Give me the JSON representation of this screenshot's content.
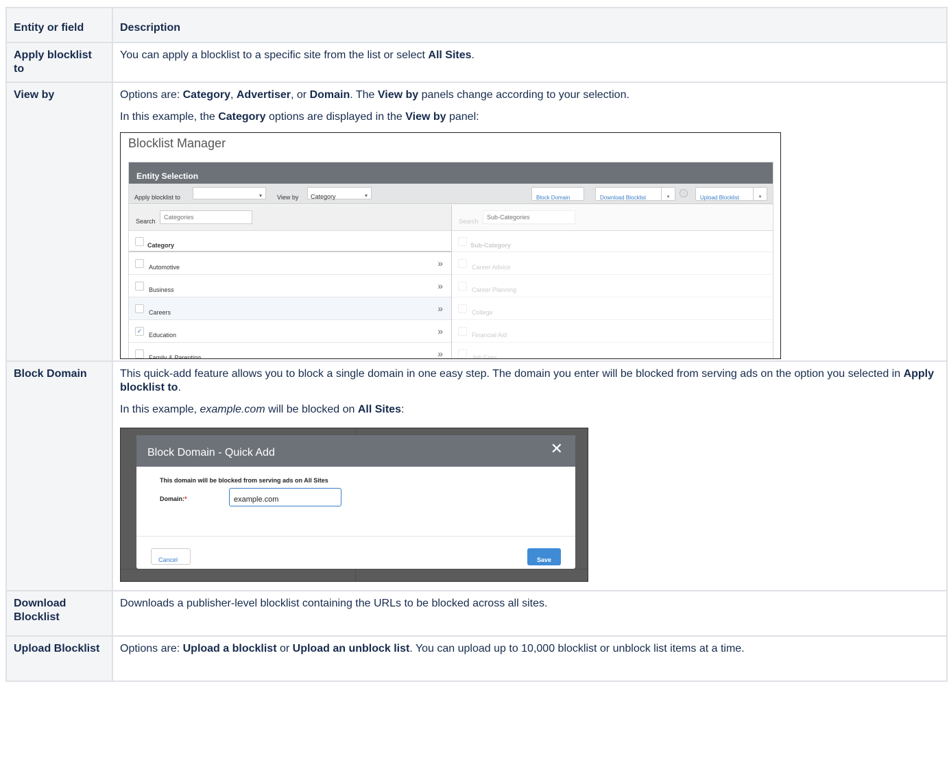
{
  "table": {
    "header_field": "Entity or field",
    "header_desc": "Description"
  },
  "rows": {
    "apply": {
      "field": "Apply blocklist to",
      "t1": "You can apply a blocklist to a specific site from the list or select ",
      "b1": "All Sites",
      "t2": "."
    },
    "viewby": {
      "field": "View by",
      "p1": {
        "t1": "Options are: ",
        "b1": "Category",
        "t2": ", ",
        "b2": "Advertiser",
        "t3": ", or ",
        "b3": "Domain",
        "t4": ". The ",
        "b4": "View by",
        "t5": " panels change according to your selection."
      },
      "p2": {
        "t1": "In this example, the ",
        "b1": "Category",
        "t2": " options are displayed in the ",
        "b2": "View by",
        "t3": " panel:"
      }
    },
    "block": {
      "field": "Block Domain",
      "p1": {
        "t1": "This quick-add feature allows you to block a single domain in one easy step. The domain you enter will be blocked from serving ads on the option you selected in ",
        "b1": "Apply blocklist to",
        "t2": "."
      },
      "p2": {
        "t1": "In this example, ",
        "i1": "example.com",
        "t2": " will be blocked on ",
        "b1": "All Sites",
        "t3": ":"
      }
    },
    "download": {
      "field": "Download Blocklist",
      "text": "Downloads a publisher-level blocklist containing the URLs to be blocked across all sites."
    },
    "upload": {
      "field": "Upload Blocklist",
      "t1": "Options are: ",
      "b1": "Upload a blocklist",
      "t2": " or ",
      "b2": "Upload an unblock list",
      "t3": ". You can upload up to 10,000 blocklist or unblock list items at a time."
    }
  },
  "blocklist_manager": {
    "title": "Blocklist Manager",
    "panel_title": "Entity Selection",
    "apply_label": "Apply blocklist to",
    "apply_value": "",
    "viewby_label": "View by",
    "viewby_value": "Category",
    "block_domain_btn": "Block Domain",
    "download_btn": "Download Blocklist",
    "upload_btn": "Upload Blocklist",
    "search_label": "Search",
    "search_placeholder": "Categories",
    "sub_search_placeholder": "Sub-Categories",
    "category_header": "Category",
    "subcategory_header": "Sub-Category",
    "categories": [
      {
        "label": "Automotive",
        "checked": false
      },
      {
        "label": "Business",
        "checked": false
      },
      {
        "label": "Careers",
        "checked": false
      },
      {
        "label": "Education",
        "checked": true
      },
      {
        "label": "Family & Parenting",
        "checked": false
      }
    ],
    "subcategories": [
      "Career Advice",
      "Career Planning",
      "College",
      "Financial Aid",
      "Job Fairs"
    ]
  },
  "block_domain_modal": {
    "title": "Block Domain - Quick Add",
    "message": "This domain will be blocked from serving ads on All Sites",
    "domain_label": "Domain:",
    "required_mark": "*",
    "domain_value": "example.com",
    "cancel": "Cancel",
    "save": "Save"
  },
  "icons": {
    "chevron": "»",
    "caret": "▾",
    "close": "✕",
    "check": "✓",
    "info": "i"
  }
}
